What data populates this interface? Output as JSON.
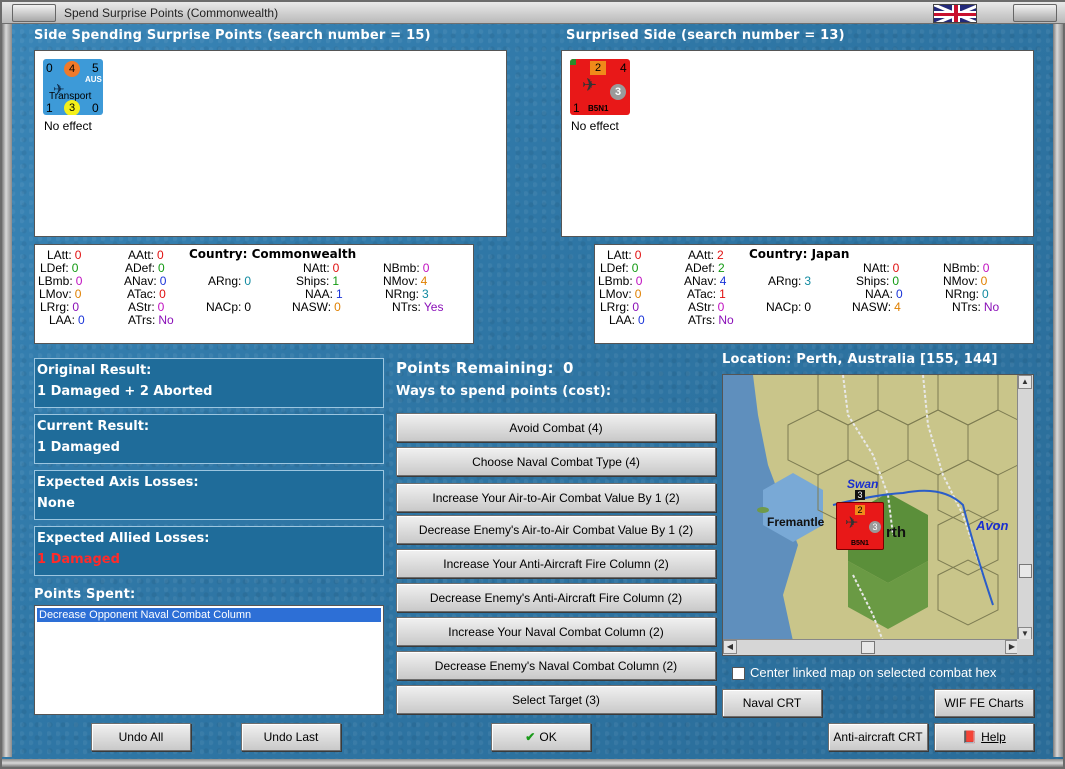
{
  "window": {
    "title": "Spend Surprise Points (Commonwealth)"
  },
  "left": {
    "heading": "Side Spending Surprise Points (search number = 15)",
    "unit": {
      "top_left": "0",
      "top_mid": "4",
      "top_right": "5",
      "nation": "AUS",
      "type": "Transport",
      "bottom_left": "1",
      "bottom_mid": "3",
      "bottom_right": "0",
      "effect": "No effect"
    },
    "stats": {
      "latt": "LAtt:",
      "latt_v": "0",
      "aatt": "AAtt:",
      "aatt_v": "0",
      "ldef": "LDef:",
      "ldef_v": "0",
      "adef": "ADef:",
      "adef_v": "0",
      "lbmb": "LBmb:",
      "lbmb_v": "0",
      "anav": "ANav:",
      "anav_v": "0",
      "lmov": "LMov:",
      "lmov_v": "0",
      "atac": "ATac:",
      "atac_v": "0",
      "lrrg": "LRrg:",
      "lrrg_v": "0",
      "astr": "AStr:",
      "astr_v": "0",
      "laa": "LAA:",
      "laa_v": "0",
      "atrs": "ATrs:",
      "atrs_v": "No",
      "country": "Country: Commonwealth",
      "natt": "NAtt:",
      "natt_v": "0",
      "nbmb": "NBmb:",
      "nbmb_v": "0",
      "arng": "ARng:",
      "arng_v": "0",
      "ships": "Ships:",
      "ships_v": "1",
      "nmov": "NMov:",
      "nmov_v": "4",
      "naa": "NAA:",
      "naa_v": "1",
      "nrng": "NRng:",
      "nrng_v": "3",
      "nacp": "NACp:",
      "nacp_v": "0",
      "nasw": "NASW:",
      "nasw_v": "0",
      "ntrs": "NTrs:",
      "ntrs_v": "Yes"
    }
  },
  "right": {
    "heading": "Surprised Side (search number = 13)",
    "unit": {
      "top_mid": "2",
      "top_right": "4",
      "bottom_left": "1",
      "name": "B5N1",
      "circle": "3",
      "effect": "No effect"
    },
    "stats": {
      "latt": "LAtt:",
      "latt_v": "0",
      "aatt": "AAtt:",
      "aatt_v": "2",
      "ldef": "LDef:",
      "ldef_v": "0",
      "adef": "ADef:",
      "adef_v": "2",
      "lbmb": "LBmb:",
      "lbmb_v": "0",
      "anav": "ANav:",
      "anav_v": "4",
      "lmov": "LMov:",
      "lmov_v": "0",
      "atac": "ATac:",
      "atac_v": "1",
      "lrrg": "LRrg:",
      "lrrg_v": "0",
      "astr": "AStr:",
      "astr_v": "0",
      "laa": "LAA:",
      "laa_v": "0",
      "atrs": "ATrs:",
      "atrs_v": "No",
      "country": "Country: Japan",
      "natt": "NAtt:",
      "natt_v": "0",
      "nbmb": "NBmb:",
      "nbmb_v": "0",
      "arng": "ARng:",
      "arng_v": "3",
      "ships": "Ships:",
      "ships_v": "0",
      "nmov": "NMov:",
      "nmov_v": "0",
      "naa": "NAA:",
      "naa_v": "0",
      "nrng": "NRng:",
      "nrng_v": "0",
      "nacp": "NACp:",
      "nacp_v": "0",
      "nasw": "NASW:",
      "nasw_v": "4",
      "ntrs": "NTrs:",
      "ntrs_v": "No"
    }
  },
  "results": {
    "original_label": "Original Result:",
    "original_value": "1 Damaged + 2 Aborted",
    "current_label": "Current Result:",
    "current_value": "1 Damaged",
    "axis_label": "Expected Axis Losses:",
    "axis_value": "None",
    "allied_label": "Expected Allied Losses:",
    "allied_value": "1 Damaged"
  },
  "points_spent": {
    "label": "Points Spent:",
    "items": [
      "Decrease Opponent Naval Combat Column"
    ]
  },
  "points": {
    "remaining_label": "Points Remaining:",
    "remaining_value": "0",
    "ways_label": "Ways to spend points (cost):",
    "options": [
      "Avoid Combat (4)",
      "Choose Naval Combat Type (4)",
      "Increase Your Air-to-Air Combat Value By 1 (2)",
      "Decrease Enemy's Air-to-Air Combat Value By 1 (2)",
      "Increase Your Anti-Aircraft Fire Column (2)",
      "Decrease Enemy's Anti-Aircraft Fire Column (2)",
      "Increase Your Naval Combat Column (2)",
      "Decrease Enemy's Naval Combat Column (2)",
      "Select Target (3)"
    ]
  },
  "map": {
    "location": "Location: Perth, Australia [155, 144]",
    "labels": {
      "swan": "Swan",
      "fremantle": "Fremantle",
      "perth_suffix": "rth",
      "avon": "Avon"
    },
    "stack_number": "3",
    "counter": {
      "top_mid": "2",
      "circle": "3",
      "name": "B5N1"
    }
  },
  "center_linked": "Center linked map on selected combat hex",
  "buttons": {
    "undo_all": "Undo All",
    "undo_last": "Undo Last",
    "ok": "OK",
    "naval_crt": "Naval CRT",
    "wif_charts": "WIF FE Charts",
    "aa_crt": "Anti-aircraft CRT",
    "help": "Help"
  },
  "colors": {
    "allied_losses": "#ff2a2a",
    "background": "#2f77a6"
  }
}
